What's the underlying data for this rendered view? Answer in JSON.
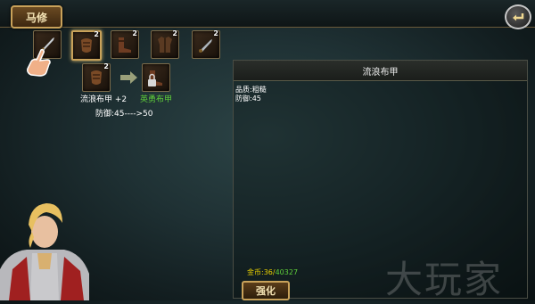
{
  "header": {
    "title": "马修",
    "back_icon": "back-arrow-icon"
  },
  "inventory": {
    "slots": [
      {
        "icon": "sword-icon",
        "level": "",
        "selected": false
      },
      {
        "icon": "gauntlet-icon",
        "level": "2",
        "selected": true
      },
      {
        "icon": "boots-icon",
        "level": "2",
        "selected": false
      },
      {
        "icon": "armor-icon",
        "level": "2",
        "selected": false
      },
      {
        "icon": "dagger-icon",
        "level": "2",
        "selected": false
      }
    ]
  },
  "upgrade": {
    "current": {
      "name": "流浪布甲 +2",
      "level": "2",
      "icon": "cloth-armor-icon"
    },
    "arrow_icon": "arrow-right-icon",
    "next": {
      "name": "英勇布甲",
      "icon": "locked-armor-icon"
    },
    "defense_text": "防御:45---->50"
  },
  "detail": {
    "title": "流浪布甲",
    "quality": "品质:粗糙",
    "defense": "防御:45"
  },
  "footer": {
    "gold_label": "金币:36/",
    "gold_value": "40327",
    "enhance_label": "强化"
  },
  "watermark": "大玩家",
  "colors": {
    "accent_gold": "#c9a25a",
    "green_text": "#5fcf3a",
    "yellow_text": "#e8d000"
  }
}
